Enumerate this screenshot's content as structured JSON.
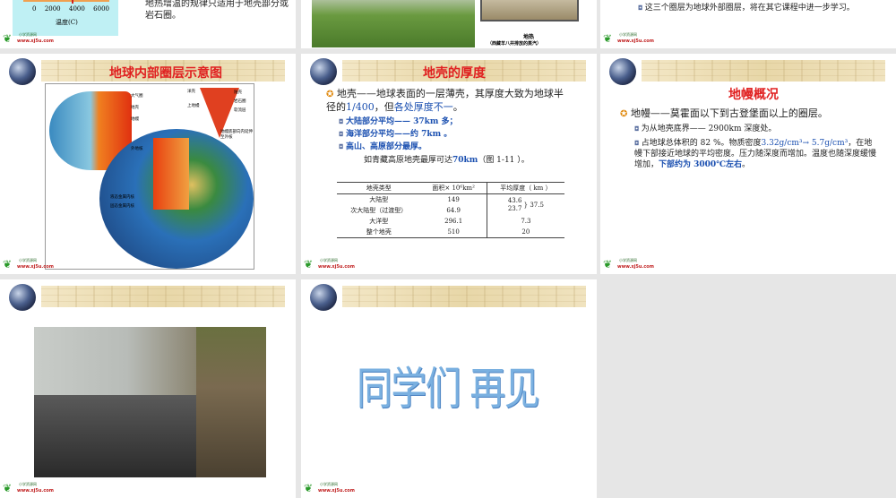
{
  "slides": [
    {
      "id": "s1",
      "axis_ticks": [
        "0",
        "2000",
        "4000",
        "6000"
      ],
      "axis_label": "温度(C)",
      "text": "地热增温的规律只适用于地壳部分或岩石圈。"
    },
    {
      "id": "s2",
      "caption_title": "地热",
      "caption": "（西藏羊八井排放的蒸汽）"
    },
    {
      "id": "s3",
      "bullet": "这三个圈层为地球外部圈层，将在其它课程中进一步学习。"
    },
    {
      "id": "s4",
      "title": "地球内部圈层示意图",
      "labels": [
        "大气圈",
        "地壳",
        "地幔",
        "外地核",
        "液态金属内核",
        "固态金属内核",
        "洋壳",
        "陆壳",
        "上地幔",
        "岩石圈",
        "软流层",
        "地幔底部向内延伸至外核"
      ]
    },
    {
      "id": "s5",
      "title": "地壳的厚度",
      "main_a": "地壳——地球表面的一层薄壳，其厚度大致为地球半径的",
      "main_b": "1/400",
      "main_c": "，但",
      "main_d": "各处厚度不一",
      "main_e": "。",
      "subs": [
        "大陆部分平均—— 37km 多；",
        "海洋部分平均——约 7km 。",
        "高山、高原部分最厚。"
      ],
      "note_a": "如青藏高原地壳最厚可达",
      "note_b": "70km",
      "note_c": "（图 1-11 ）。",
      "table": {
        "headers": [
          "地壳类型",
          "面积× 10⁶km²",
          "平均厚度（ km ）"
        ],
        "rows": [
          [
            "大陆型",
            "149",
            "43.6"
          ],
          [
            "次大陆型（过渡型）",
            "64.9",
            "23.7"
          ],
          [
            "大洋型",
            "296.1",
            "7.3"
          ],
          [
            "整个地壳",
            "510",
            "20"
          ]
        ],
        "merged": "37.5"
      }
    },
    {
      "id": "s6",
      "title": "地幔概况",
      "main": "地幔——莫霍面以下到古登堡面以上的圈层。",
      "sub1": "为从地壳底界—— 2900km 深度处。",
      "sub2_a": "占地球总体积的 82 %。物质密度",
      "sub2_b": "3.32g/cm³→ 5.7g/cm³",
      "sub2_c": "，在地幔下部接近地球的平均密度。压力随深度而增加。温度也随深度缓慢增加，",
      "sub2_d": "下部约为 3000℃左右",
      "sub2_e": "。"
    },
    {
      "id": "s7"
    },
    {
      "id": "s8",
      "text": "同学们 再见"
    }
  ],
  "logo": {
    "name": "小学资源网",
    "url": "www.xj5u.com"
  }
}
